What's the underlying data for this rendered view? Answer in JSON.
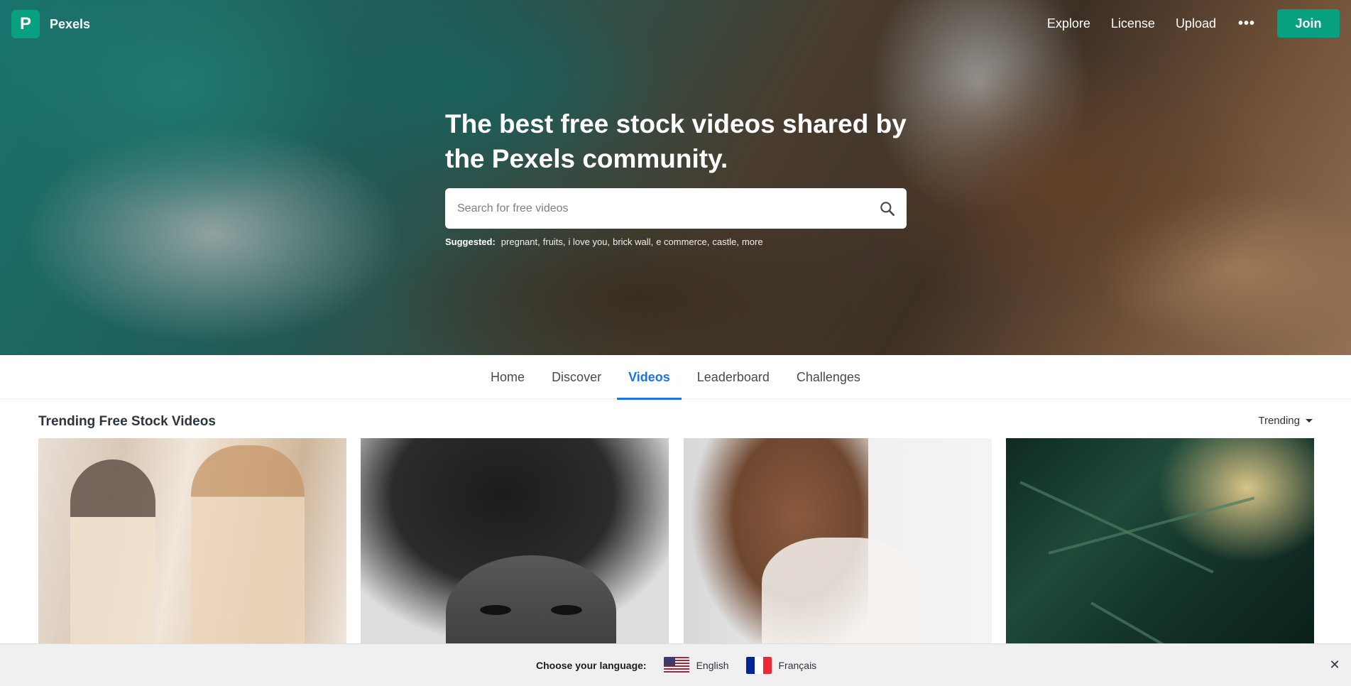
{
  "brand": {
    "name": "Pexels",
    "logo_letter": "P",
    "accent": "#07a081"
  },
  "nav": {
    "explore": "Explore",
    "license": "License",
    "upload": "Upload",
    "more": "•••",
    "join": "Join"
  },
  "hero": {
    "title": "The best free stock videos shared by the Pexels community.",
    "search_placeholder": "Search for free videos",
    "suggested_label": "Suggested:",
    "suggestions": [
      "pregnant",
      "fruits",
      "i love you",
      "brick wall",
      "e commerce",
      "castle",
      "more"
    ]
  },
  "tabs": [
    {
      "label": "Home"
    },
    {
      "label": "Discover"
    },
    {
      "label": "Videos",
      "active": true
    },
    {
      "label": "Leaderboard"
    },
    {
      "label": "Challenges"
    }
  ],
  "section": {
    "title": "Trending Free Stock Videos",
    "sort": "Trending"
  },
  "language_bar": {
    "label": "Choose your language:",
    "options": [
      "English",
      "Français"
    ],
    "close": "✕"
  }
}
